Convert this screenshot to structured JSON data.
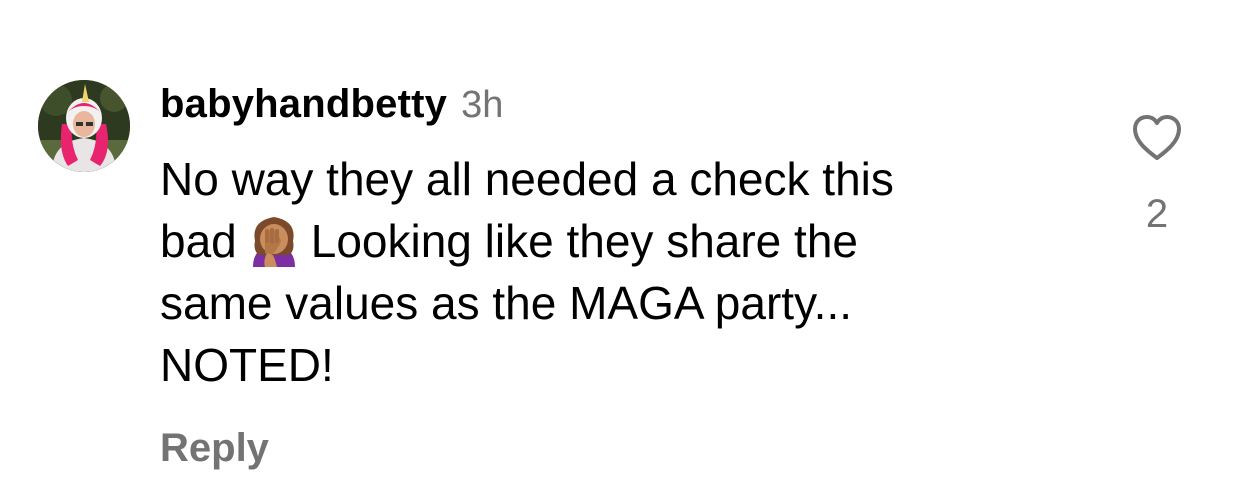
{
  "comment": {
    "username": "babyhandbetty",
    "timestamp": "3h",
    "text_lines": [
      "No way they all needed a check this",
      "bad",
      "Looking like they share the",
      "same values as the MAGA party...",
      "NOTED!"
    ],
    "emoji": "🤦🏽‍♀️",
    "reply_label": "Reply",
    "like_count": "2"
  },
  "icons": {
    "like": "heart-outline-icon",
    "avatar": "user-avatar-image",
    "emoji": "woman-facepalming-emoji"
  },
  "colors": {
    "text": "#000000",
    "secondary": "#737373",
    "background": "#ffffff"
  }
}
